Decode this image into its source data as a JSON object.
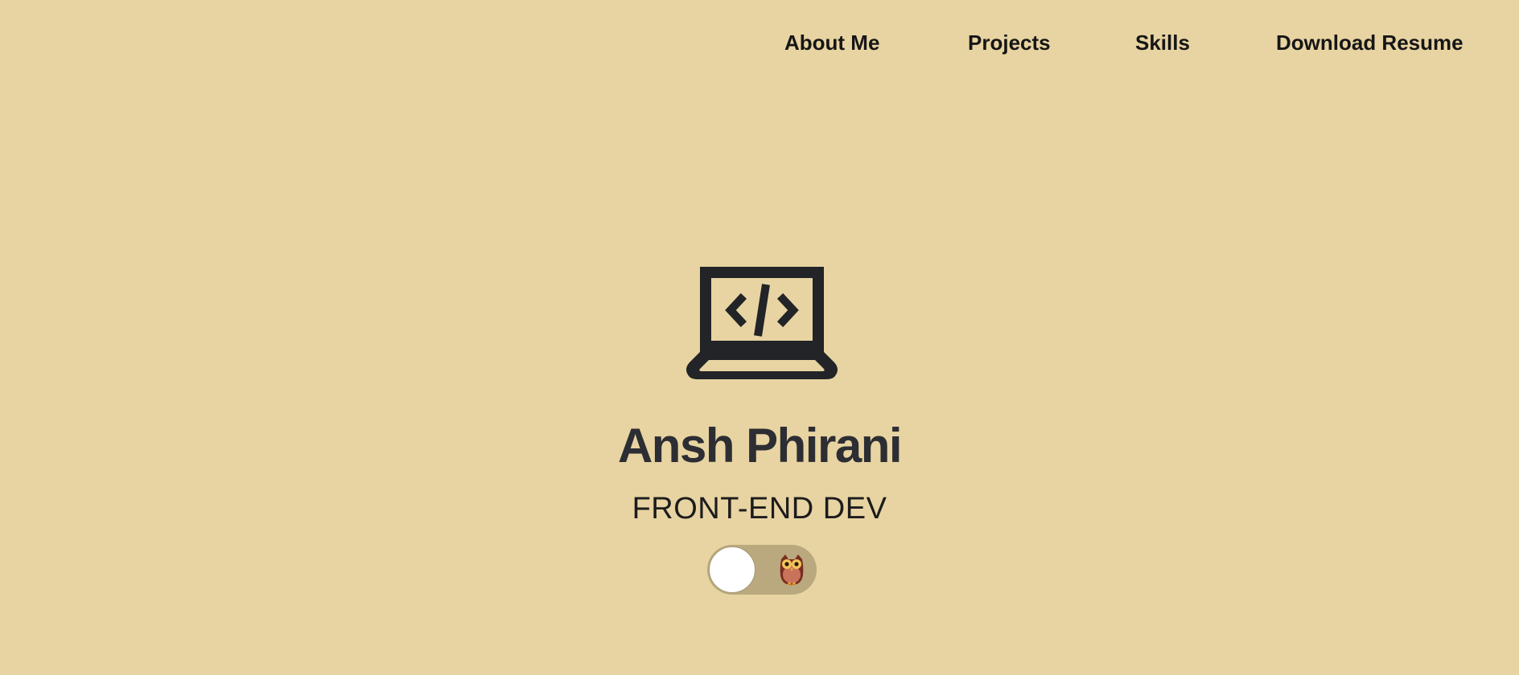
{
  "nav": {
    "items": [
      {
        "label": "About Me"
      },
      {
        "label": "Projects"
      },
      {
        "label": "Skills"
      },
      {
        "label": "Download Resume"
      }
    ]
  },
  "hero": {
    "icon": "laptop-code-icon",
    "name": "Ansh Phirani",
    "role": "FRONT-END DEV"
  },
  "theme_toggle": {
    "state": "off",
    "icon": "owl-icon"
  },
  "colors": {
    "background": "#e8d4a2",
    "toggle_track": "#baa97e",
    "text": "#2d2e33"
  }
}
